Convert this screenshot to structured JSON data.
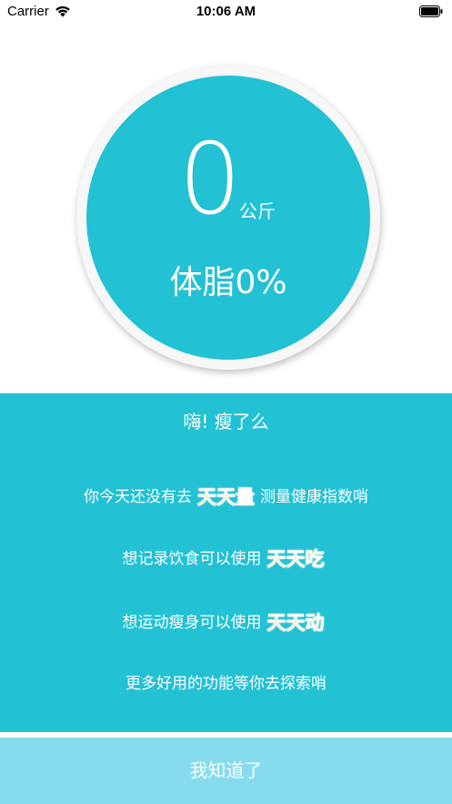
{
  "status_bar": {
    "carrier": "Carrier",
    "time": "10:06 AM"
  },
  "colors": {
    "accent": "#22c1d4",
    "button": "#86dced",
    "highlight": "#ffb300"
  },
  "weight": {
    "value": "0",
    "unit": "公斤",
    "body_fat": "体脂0%"
  },
  "panel": {
    "title": "嗨! 瘦了么",
    "line1": {
      "prefix": "你今天还没有去",
      "highlight": "天天量",
      "suffix": "测量健康指数哨"
    },
    "line2": {
      "prefix": "想记录饮食可以使用",
      "highlight": "天天吃"
    },
    "line3": {
      "prefix": "想运动瘦身可以使用",
      "highlight": "天天动"
    },
    "line4": "更多好用的功能等你去探索哨"
  },
  "button": {
    "label": "我知道了"
  }
}
